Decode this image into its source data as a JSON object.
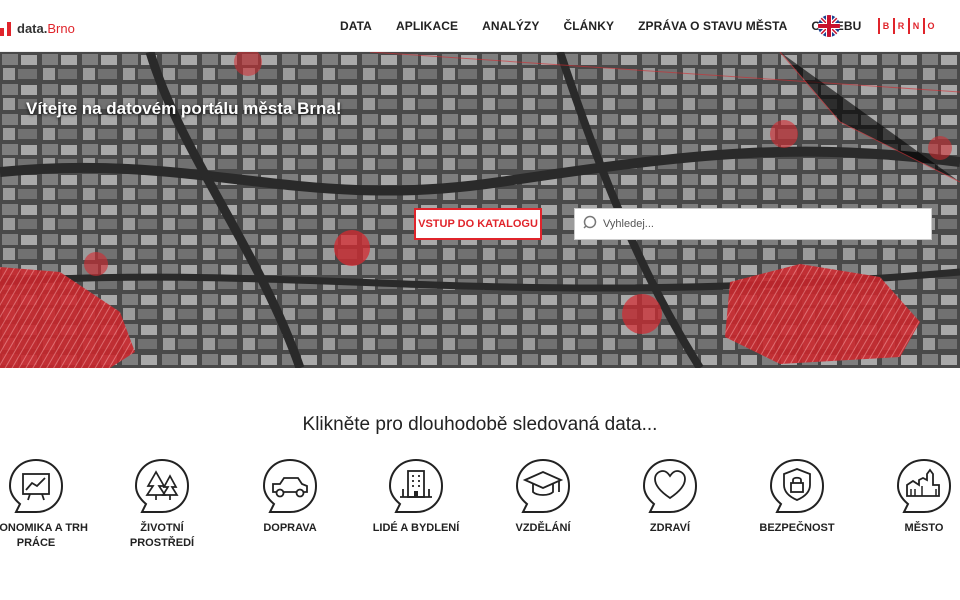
{
  "logo": {
    "text_main": "data.",
    "text_accent": "Brno"
  },
  "nav": {
    "items": [
      {
        "label": "DATA"
      },
      {
        "label": "APLIKACE"
      },
      {
        "label": "ANALÝZY"
      },
      {
        "label": "ČLÁNKY"
      },
      {
        "label": "ZPRÁVA O STAVU MĚSTA"
      },
      {
        "label": "O WEBU"
      }
    ],
    "brno_letters": [
      "B",
      "R",
      "N",
      "O"
    ]
  },
  "hero": {
    "welcome": "Vítejte na datovém portálu města Brna!",
    "catalog_button": "VSTUP DO KATALOGU",
    "search_placeholder": "Vyhledej..."
  },
  "section": {
    "title": "Klikněte pro dlouhodobě sledovaná data...",
    "categories": [
      {
        "label": "EKONOMIKA A TRH PRÁCE",
        "icon": "economy-chart-icon"
      },
      {
        "label": "ŽIVOTNÍ PROSTŘEDÍ",
        "icon": "trees-icon"
      },
      {
        "label": "DOPRAVA",
        "icon": "car-icon"
      },
      {
        "label": "LIDÉ A BYDLENÍ",
        "icon": "building-icon"
      },
      {
        "label": "VZDĚLÁNÍ",
        "icon": "graduation-cap-icon"
      },
      {
        "label": "ZDRAVÍ",
        "icon": "heart-icon"
      },
      {
        "label": "BEZPEČNOST",
        "icon": "shield-lock-icon"
      },
      {
        "label": "MĚSTO",
        "icon": "castle-icon"
      }
    ]
  },
  "colors": {
    "accent": "#e0242b",
    "text": "#222222"
  }
}
